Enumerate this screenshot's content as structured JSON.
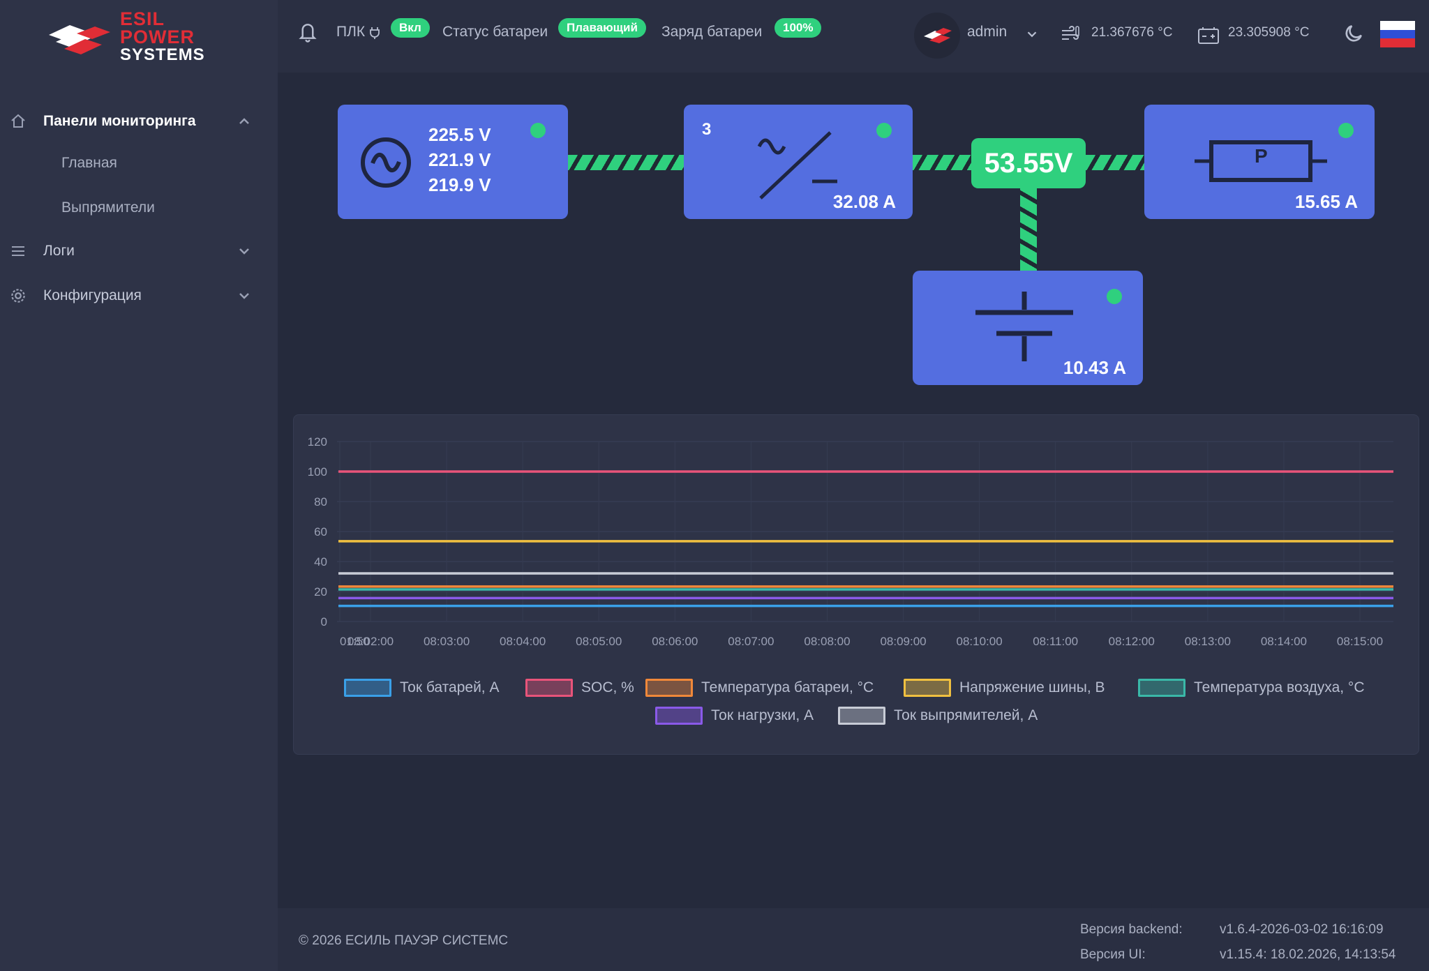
{
  "brand": {
    "line1": "ESIL",
    "line2": "POWER",
    "line3": "SYSTEMS"
  },
  "sidebar": {
    "items": [
      {
        "label": "Панели мониторинга",
        "icon": "home-icon",
        "expanded": true
      },
      {
        "label": "Логи",
        "icon": "list-icon",
        "expanded": false
      },
      {
        "label": "Конфигурация",
        "icon": "gear-icon",
        "expanded": false
      }
    ],
    "subitems": [
      {
        "label": "Главная"
      },
      {
        "label": "Выпрямители"
      }
    ]
  },
  "header": {
    "plc_label": "ПЛК",
    "plc_badge": "Вкл",
    "battery_status_label": "Статус батареи",
    "battery_status_badge": "Плавающий",
    "battery_charge_label": "Заряд батареи",
    "battery_charge_badge": "100%",
    "user": "admin",
    "temp_air": "21.367676 °C",
    "temp_battery": "23.305908 °C",
    "language_flag": "russia-flag-icon"
  },
  "diagram": {
    "ac_input": {
      "v1": "225.5 V",
      "v2": "221.9 V",
      "v3": "219.9 V"
    },
    "rectifier": {
      "count": "3",
      "current": "32.08 A"
    },
    "bus_voltage": "53.55V",
    "load": {
      "label": "P",
      "current": "15.65 A"
    },
    "battery": {
      "current": "10.43 A"
    },
    "status_color": "#2fd07e",
    "block_color": "#546ee0"
  },
  "chart_data": {
    "type": "line",
    "y_ticks": [
      "0",
      "20",
      "40",
      "60",
      "80",
      "100",
      "120"
    ],
    "ylim": [
      0,
      120
    ],
    "x_ticks": [
      "01:50",
      "08:02:00",
      "08:03:00",
      "08:04:00",
      "08:05:00",
      "08:06:00",
      "08:07:00",
      "08:08:00",
      "08:09:00",
      "08:10:00",
      "08:11:00",
      "08:12:00",
      "08:13:00",
      "08:14:00",
      "08:15:00"
    ],
    "series": [
      {
        "name": "Ток батарей, А",
        "color": "#3aa0e8",
        "value": 10.43
      },
      {
        "name": "SOC, %",
        "color": "#e8547a",
        "value": 100
      },
      {
        "name": "Температура батареи, °C",
        "color": "#f0883a",
        "value": 23.3
      },
      {
        "name": "Напряжение шины, В",
        "color": "#f0c040",
        "value": 53.55
      },
      {
        "name": "Температура воздуха, °C",
        "color": "#3ab8a8",
        "value": 21.37
      },
      {
        "name": "Ток нагрузки, А",
        "color": "#8a5ae8",
        "value": 15.65
      },
      {
        "name": "Ток выпрямителей, А",
        "color": "#c8ccd6",
        "value": 32.08
      }
    ],
    "grid": true,
    "legend_placement": "bottom"
  },
  "footer": {
    "copyright": "© 2026 ЕСИЛЬ ПАУЭР СИСТЕМС",
    "backend_label": "Версия backend:",
    "backend_value": "v1.6.4-2026-03-02 16:16:09",
    "ui_label": "Версия UI:",
    "ui_value": "v1.15.4: 18.02.2026, 14:13:54"
  }
}
